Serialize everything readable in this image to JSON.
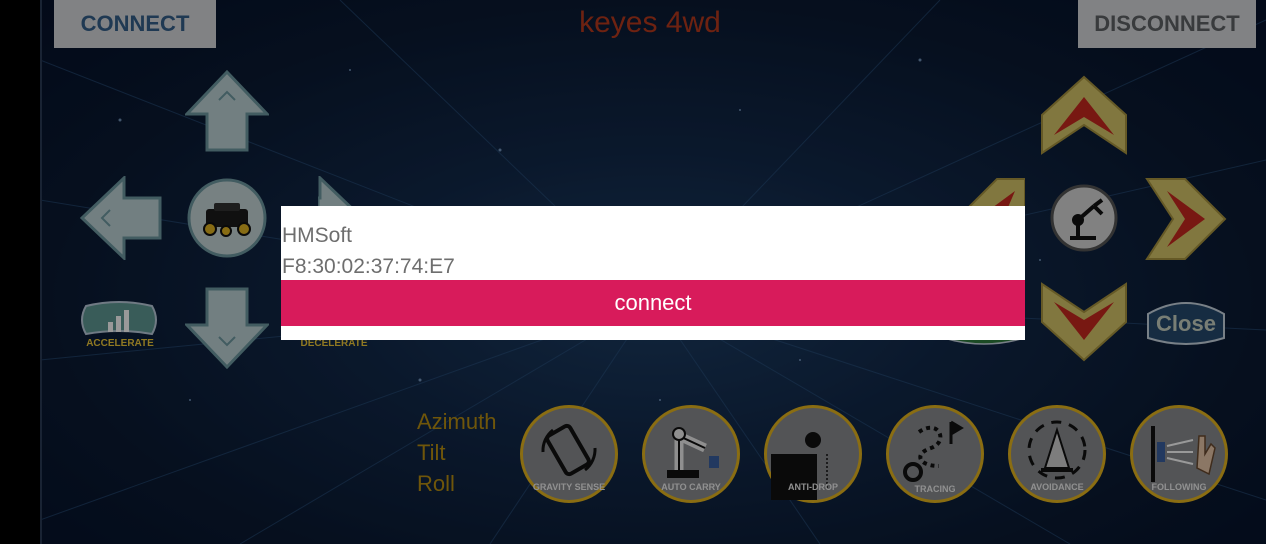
{
  "app": {
    "title": "keyes 4wd"
  },
  "header": {
    "connect_label": "CONNECT",
    "disconnect_label": "DISCONNECT"
  },
  "left_pad": {
    "accelerate_label": "ACCELERATE",
    "decelerate_label": "DECELERATE"
  },
  "right_pad": {
    "close_label": "Close"
  },
  "sensors": {
    "azimuth": "Azimuth",
    "tilt": "Tilt",
    "roll": "Roll"
  },
  "modes": [
    {
      "label": "GRAVITY SENSE",
      "icon": "phone-rotate-icon"
    },
    {
      "label": "AUTO CARRY",
      "icon": "robot-arm-icon"
    },
    {
      "label": "ANTI-DROP",
      "icon": "cliff-ball-icon"
    },
    {
      "label": "TRACING",
      "icon": "path-flag-icon"
    },
    {
      "label": "AVOIDANCE",
      "icon": "traffic-cone-icon"
    },
    {
      "label": "FOLLOWING",
      "icon": "hand-wave-icon"
    }
  ],
  "dialog": {
    "device_name": "HMSoft",
    "device_address": "F8:30:02:37:74:E7",
    "connect_label": "connect"
  },
  "colors": {
    "accent": "#d81b5b",
    "title": "#b8391d",
    "mode_border": "#e6b61e",
    "arrow_yellow": "#d7c66a",
    "arrow_red": "#c8281e"
  }
}
